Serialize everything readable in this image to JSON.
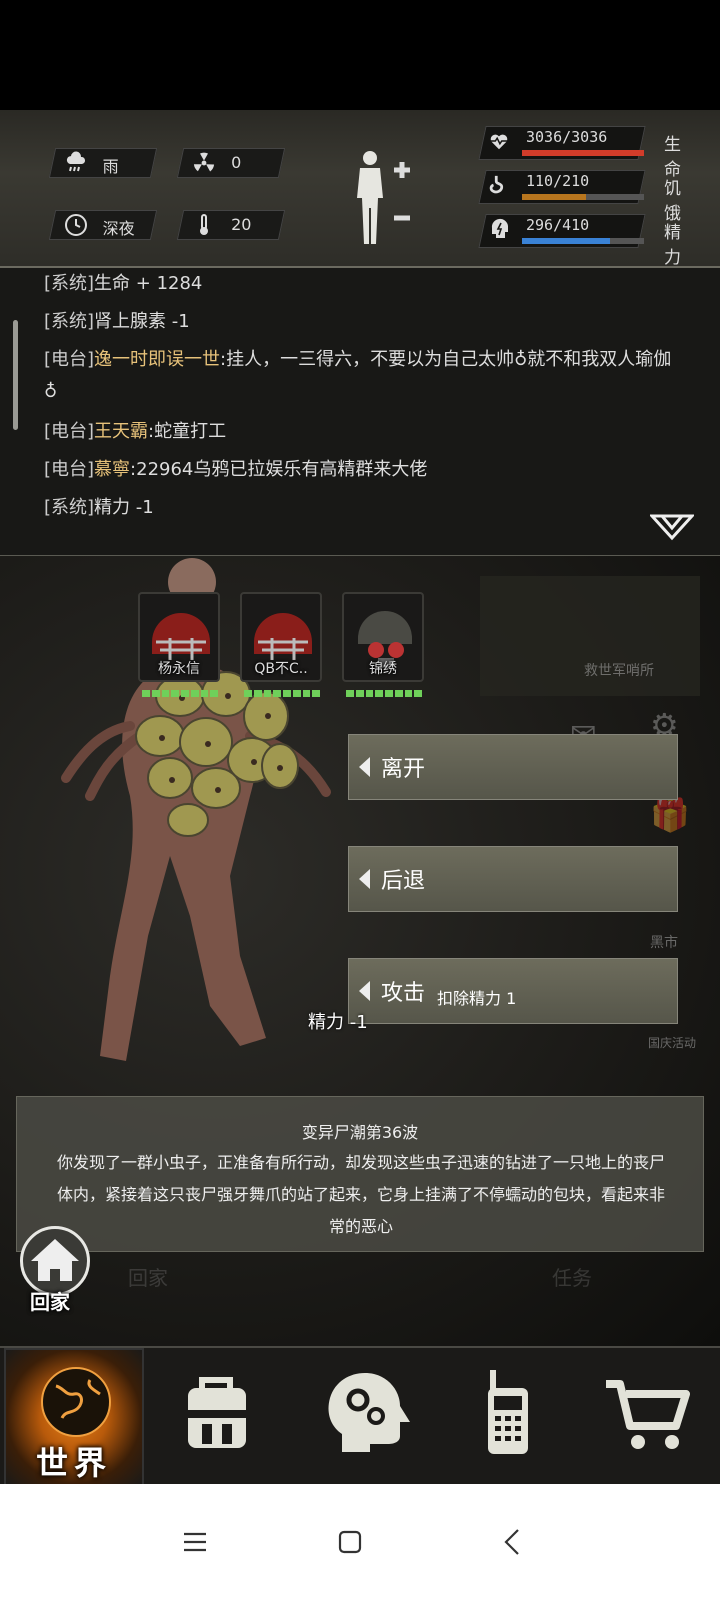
{
  "status": {
    "weather": "雨",
    "radiation": "0",
    "time": "深夜",
    "temperature": "20",
    "stats": [
      {
        "name": "life",
        "value": "3036/3036",
        "label": "生命",
        "fraction": 1.0,
        "color": "#d13c2a",
        "icon": "heart-pulse-icon"
      },
      {
        "name": "hunger",
        "value": "110/210",
        "label": "饥饿",
        "fraction": 0.524,
        "color": "#b8761e",
        "icon": "stomach-icon"
      },
      {
        "name": "energy",
        "value": "296/410",
        "label": "精力",
        "fraction": 0.722,
        "color": "#3a82d6",
        "icon": "lightning-head-icon"
      }
    ]
  },
  "log": [
    {
      "tag": "[系统]",
      "name": "",
      "text": "生命 + 1284"
    },
    {
      "tag": "[系统]",
      "name": "",
      "text": "肾上腺素 -1"
    },
    {
      "tag": "[电台]",
      "name": "逸一时即误一世",
      "text": ":挂人，一三得六，不要以为自己太帅♁就不和我双人瑜伽♁"
    },
    {
      "tag": "[电台]",
      "name": "王天霸",
      "text": ":蛇童打工"
    },
    {
      "tag": "[电台]",
      "name": "慕寧",
      "text": ":22964乌鸦已拉娱乐有高精群来大佬"
    },
    {
      "tag": "[系统]",
      "name": "",
      "text": "精力 -1"
    }
  ],
  "party": [
    {
      "name": "杨永信"
    },
    {
      "name": "QB不C.."
    },
    {
      "name": "锦绣"
    }
  ],
  "actions": {
    "leave": "离开",
    "retreat": "后退",
    "attack": "攻击",
    "attack_cost": "扣除精力 1"
  },
  "background_labels": {
    "outpost": "救世军哨所",
    "black_market": "黑市",
    "national_day": "国庆活动",
    "home_ghost": "回家",
    "task_ghost": "任务"
  },
  "floating_message": "精力 -1",
  "event": {
    "title": "变异尸潮第36波",
    "text": "你发现了一群小虫子，正准备有所行动，却发现这些虫子迅速的钻进了一只地上的丧尸体内，紧接着这只丧尸强牙舞爪的站了起来，它身上挂满了不停蠕动的包块，看起来非常的恶心"
  },
  "home": {
    "label": "回家"
  },
  "nav": {
    "world_label": "世界"
  }
}
